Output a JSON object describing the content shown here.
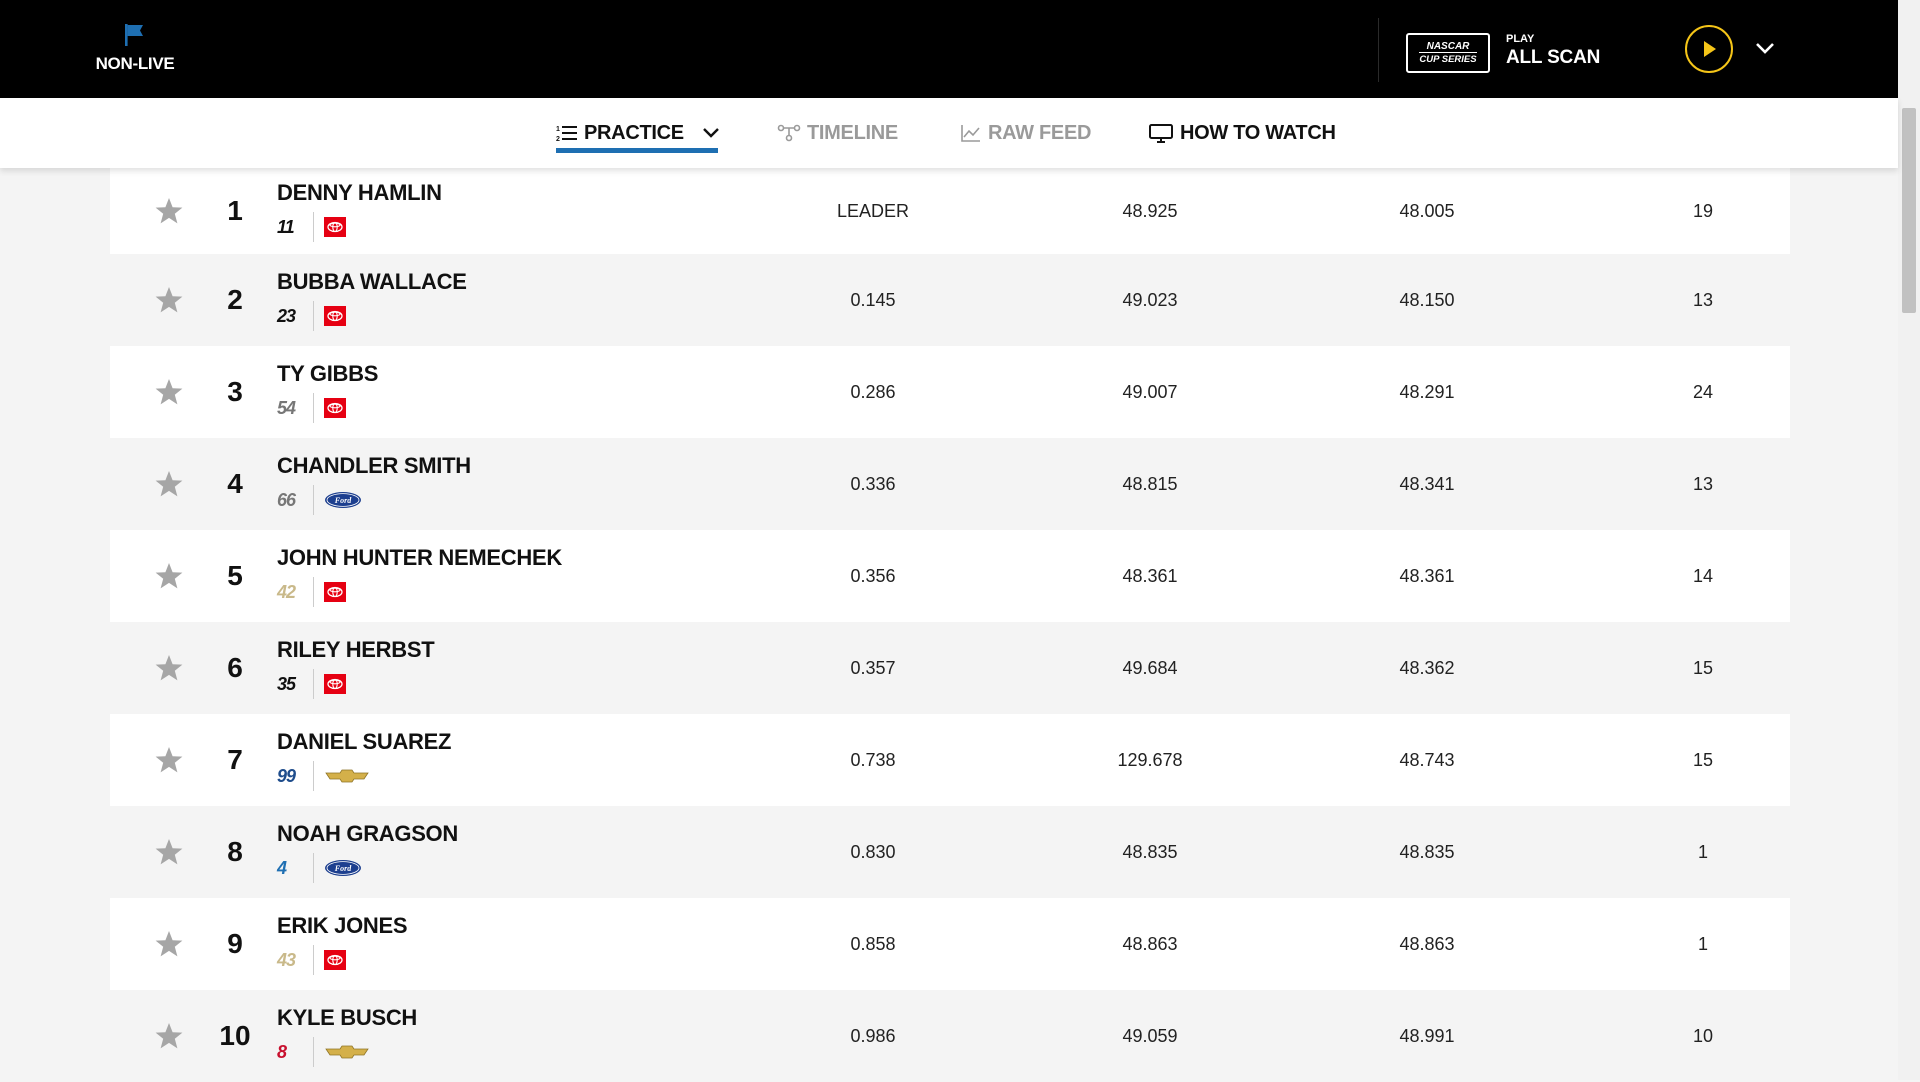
{
  "header": {
    "status_label": "NON-LIVE",
    "series_logo_line1": "NASCAR",
    "series_logo_line2": "CUP SERIES",
    "play_small": "PLAY",
    "play_big": "ALL SCAN",
    "accent_color": "#f5c518"
  },
  "tabs": [
    {
      "label": "PRACTICE",
      "icon": "list-icon",
      "active": true
    },
    {
      "label": "TIMELINE",
      "icon": "timeline-icon"
    },
    {
      "label": "RAW FEED",
      "icon": "chart-line-icon"
    },
    {
      "label": "HOW TO WATCH",
      "icon": "monitor-icon"
    }
  ],
  "rows": [
    {
      "pos": "1",
      "name": "DENNY HAMLIN",
      "car": "11",
      "mfr": "toyota",
      "c1": "LEADER",
      "c2": "48.925",
      "c3": "48.005",
      "c4": "19"
    },
    {
      "pos": "2",
      "name": "BUBBA WALLACE",
      "car": "23",
      "mfr": "toyota",
      "c1": "0.145",
      "c2": "49.023",
      "c3": "48.150",
      "c4": "13"
    },
    {
      "pos": "3",
      "name": "TY GIBBS",
      "car": "54",
      "mfr": "toyota",
      "c1": "0.286",
      "c2": "49.007",
      "c3": "48.291",
      "c4": "24"
    },
    {
      "pos": "4",
      "name": "CHANDLER SMITH",
      "car": "66",
      "mfr": "ford",
      "c1": "0.336",
      "c2": "48.815",
      "c3": "48.341",
      "c4": "13"
    },
    {
      "pos": "5",
      "name": "JOHN HUNTER NEMECHEK",
      "car": "42",
      "mfr": "toyota",
      "c1": "0.356",
      "c2": "48.361",
      "c3": "48.361",
      "c4": "14"
    },
    {
      "pos": "6",
      "name": "RILEY HERBST",
      "car": "35",
      "mfr": "toyota",
      "c1": "0.357",
      "c2": "49.684",
      "c3": "48.362",
      "c4": "15"
    },
    {
      "pos": "7",
      "name": "DANIEL SUAREZ",
      "car": "99",
      "mfr": "chevrolet",
      "c1": "0.738",
      "c2": "129.678",
      "c3": "48.743",
      "c4": "15"
    },
    {
      "pos": "8",
      "name": "NOAH GRAGSON",
      "car": "4",
      "mfr": "ford",
      "c1": "0.830",
      "c2": "48.835",
      "c3": "48.835",
      "c4": "1"
    },
    {
      "pos": "9",
      "name": "ERIK JONES",
      "car": "43",
      "mfr": "toyota",
      "c1": "0.858",
      "c2": "48.863",
      "c3": "48.863",
      "c4": "1"
    },
    {
      "pos": "10",
      "name": "KYLE BUSCH",
      "car": "8",
      "mfr": "chevrolet",
      "c1": "0.986",
      "c2": "49.059",
      "c3": "48.991",
      "c4": "10"
    }
  ],
  "car_colors": {
    "11": "#111",
    "23": "#111",
    "54": "#777",
    "66": "#777",
    "42": "#c9b98a",
    "35": "#111",
    "99": "#1f4d8c",
    "4": "#1f6fb2",
    "43": "#c9b98a",
    "8": "#c8102e"
  }
}
